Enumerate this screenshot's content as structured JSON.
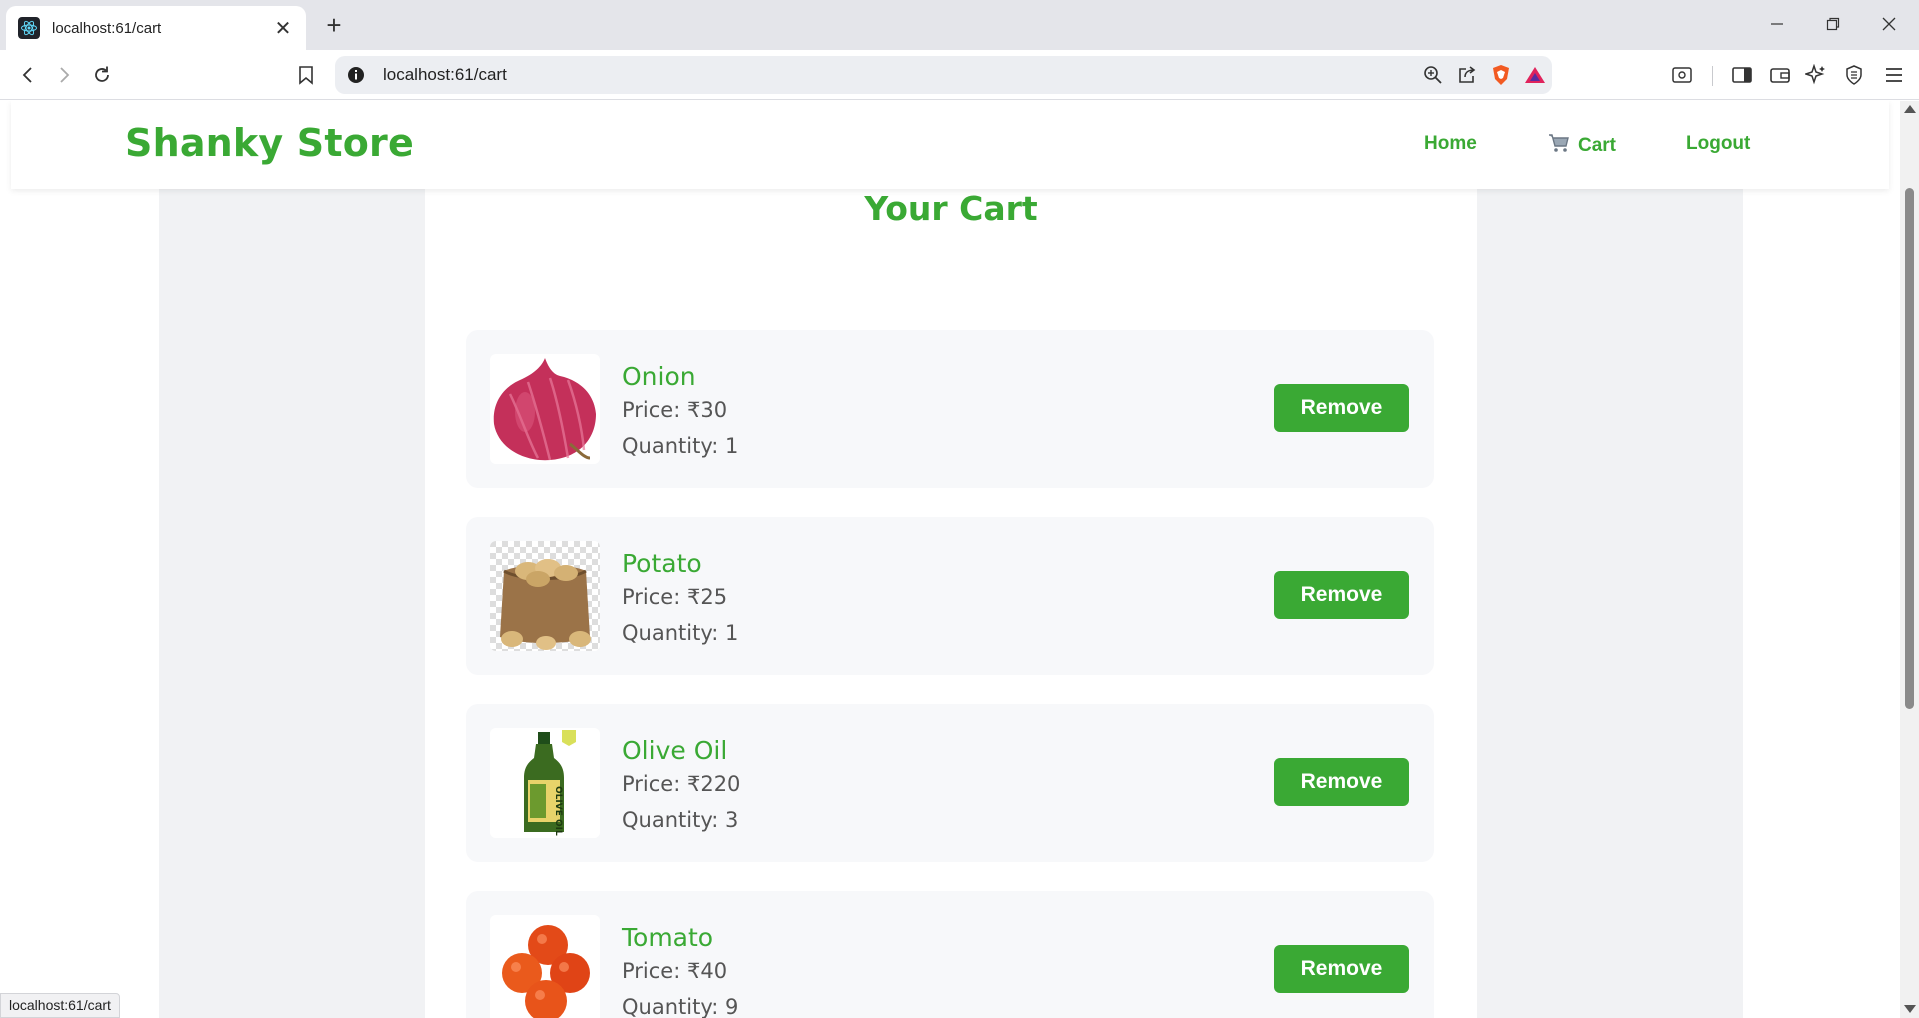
{
  "browser": {
    "tab_title": "localhost:61/cart",
    "url": "localhost:61/cart",
    "status_url": "localhost:61/cart"
  },
  "navbar": {
    "brand": "Shanky Store",
    "links": {
      "home": "Home",
      "cart": "Cart",
      "logout": "Logout"
    }
  },
  "cart": {
    "title": "Your Cart",
    "remove_label": "Remove",
    "items": [
      {
        "name": "Onion",
        "price": "Price: ₹30",
        "quantity": "Quantity: 1"
      },
      {
        "name": "Potato",
        "price": "Price: ₹25",
        "quantity": "Quantity: 1"
      },
      {
        "name": "Olive Oil",
        "price": "Price: ₹220",
        "quantity": "Quantity: 3"
      },
      {
        "name": "Tomato",
        "price": "Price: ₹40",
        "quantity": "Quantity: 9"
      }
    ]
  },
  "colors": {
    "accent": "#3aa934",
    "page_bg": "#f1f2f4",
    "item_bg": "#f7f8fa"
  },
  "icons": [
    "react-favicon-icon",
    "close-icon",
    "plus-icon",
    "minimize-icon",
    "restore-icon",
    "window-close-icon",
    "back-icon",
    "forward-icon",
    "reload-icon",
    "bookmark-icon",
    "info-icon",
    "zoom-icon",
    "share-icon",
    "brave-shield-icon",
    "brave-rewards-icon",
    "reader-icon",
    "sidebar-icon",
    "wallet-icon",
    "leo-ai-icon",
    "vpn-icon",
    "menu-icon",
    "cart-icon"
  ]
}
